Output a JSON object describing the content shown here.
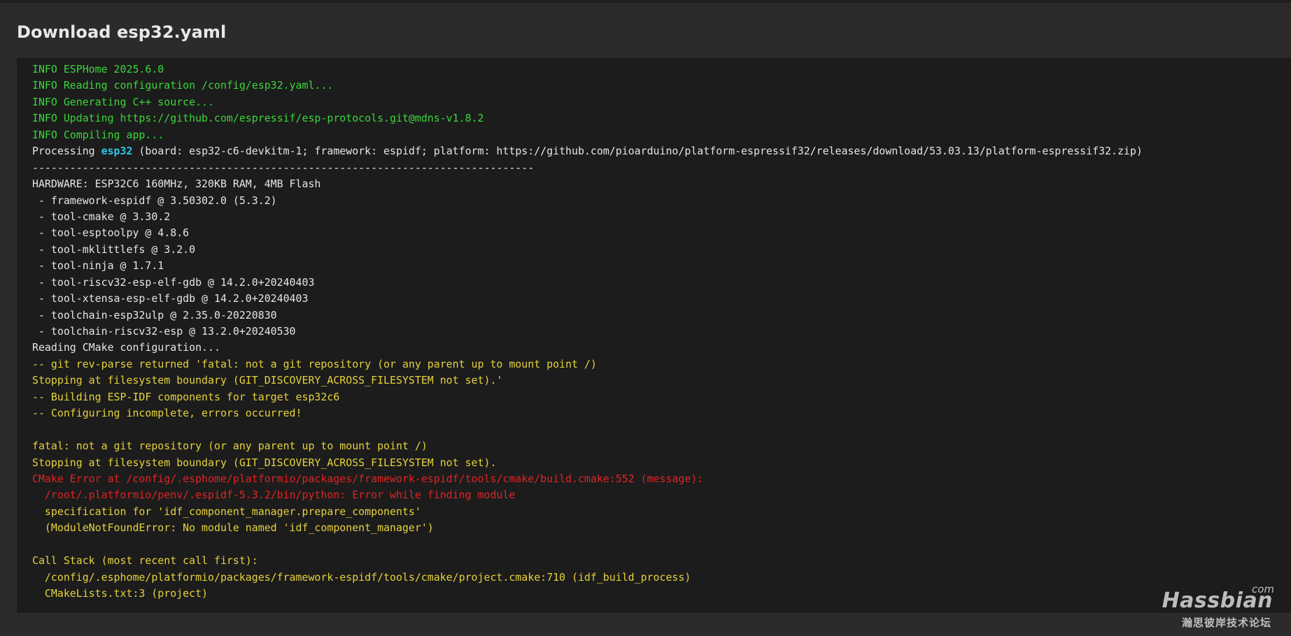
{
  "dialog": {
    "title": "Download esp32.yaml"
  },
  "log": {
    "lines": [
      {
        "color": "green",
        "text": "INFO ESPHome 2025.6.0"
      },
      {
        "color": "green",
        "text": "INFO Reading configuration /config/esp32.yaml..."
      },
      {
        "color": "green",
        "text": "INFO Generating C++ source..."
      },
      {
        "color": "green",
        "text": "INFO Updating https://github.com/espressif/esp-protocols.git@mdns-v1.8.2"
      },
      {
        "color": "green",
        "text": "INFO Compiling app..."
      },
      {
        "color": "white",
        "prefix": "Processing ",
        "highlight": "esp32",
        "suffix": " (board: esp32-c6-devkitm-1; framework: espidf; platform: https://github.com/pioarduino/platform-espressif32/releases/download/53.03.13/platform-espressif32.zip)"
      },
      {
        "color": "white",
        "text": "--------------------------------------------------------------------------------"
      },
      {
        "color": "white",
        "text": "HARDWARE: ESP32C6 160MHz, 320KB RAM, 4MB Flash"
      },
      {
        "color": "white",
        "text": " - framework-espidf @ 3.50302.0 (5.3.2)"
      },
      {
        "color": "white",
        "text": " - tool-cmake @ 3.30.2"
      },
      {
        "color": "white",
        "text": " - tool-esptoolpy @ 4.8.6"
      },
      {
        "color": "white",
        "text": " - tool-mklittlefs @ 3.2.0"
      },
      {
        "color": "white",
        "text": " - tool-ninja @ 1.7.1"
      },
      {
        "color": "white",
        "text": " - tool-riscv32-esp-elf-gdb @ 14.2.0+20240403"
      },
      {
        "color": "white",
        "text": " - tool-xtensa-esp-elf-gdb @ 14.2.0+20240403"
      },
      {
        "color": "white",
        "text": " - toolchain-esp32ulp @ 2.35.0-20220830"
      },
      {
        "color": "white",
        "text": " - toolchain-riscv32-esp @ 13.2.0+20240530"
      },
      {
        "color": "white",
        "text": "Reading CMake configuration..."
      },
      {
        "color": "yellow",
        "text": "-- git rev-parse returned 'fatal: not a git repository (or any parent up to mount point /)"
      },
      {
        "color": "yellow",
        "text": "Stopping at filesystem boundary (GIT_DISCOVERY_ACROSS_FILESYSTEM not set).'"
      },
      {
        "color": "yellow",
        "text": "-- Building ESP-IDF components for target esp32c6"
      },
      {
        "color": "yellow",
        "text": "-- Configuring incomplete, errors occurred!"
      },
      {
        "color": "yellow",
        "text": ""
      },
      {
        "color": "yellow",
        "text": "fatal: not a git repository (or any parent up to mount point /)"
      },
      {
        "color": "yellow",
        "text": "Stopping at filesystem boundary (GIT_DISCOVERY_ACROSS_FILESYSTEM not set)."
      },
      {
        "color": "red",
        "text": "CMake Error at /config/.esphome/platformio/packages/framework-espidf/tools/cmake/build.cmake:552 (message):"
      },
      {
        "color": "red",
        "text": "  /root/.platformio/penv/.espidf-5.3.2/bin/python: Error while finding module"
      },
      {
        "color": "yellow",
        "text": "  specification for 'idf_component_manager.prepare_components'"
      },
      {
        "color": "yellow",
        "text": "  (ModuleNotFoundError: No module named 'idf_component_manager')"
      },
      {
        "color": "yellow",
        "text": ""
      },
      {
        "color": "yellow",
        "text": "Call Stack (most recent call first):"
      },
      {
        "color": "yellow",
        "text": "  /config/.esphome/platformio/packages/framework-espidf/tools/cmake/project.cmake:710 (idf_build_process)"
      },
      {
        "color": "yellow",
        "text": "  CMakeLists.txt:3 (project)"
      }
    ]
  },
  "watermark": {
    "tld": "com",
    "name": "Hassbian",
    "subtitle": "瀚思彼岸技术论坛"
  }
}
